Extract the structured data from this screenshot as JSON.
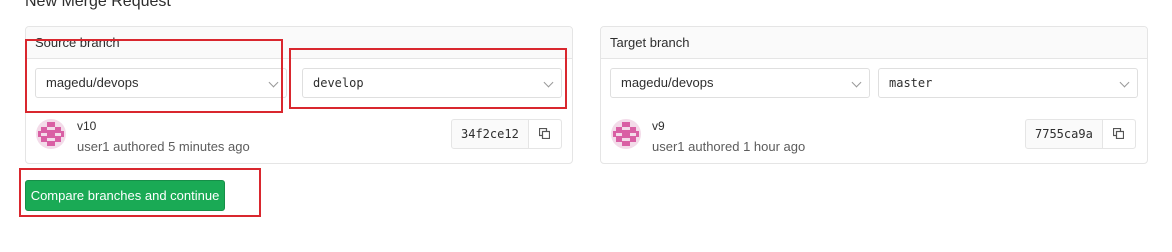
{
  "page": {
    "title": "New Merge Request"
  },
  "source": {
    "header": "Source branch",
    "project": "magedu/devops",
    "branch": "develop",
    "commit": {
      "title": "v10",
      "meta": "user1 authored 5 minutes ago",
      "sha": "34f2ce12"
    }
  },
  "target": {
    "header": "Target branch",
    "project": "magedu/devops",
    "branch": "master",
    "commit": {
      "title": "v9",
      "meta": "user1 authored 1 hour ago",
      "sha": "7755ca9a"
    }
  },
  "actions": {
    "compare_label": "Compare branches and continue"
  },
  "colors": {
    "accent_green": "#1aaa55",
    "annotation_red": "#d9272e",
    "avatar_pink": "#d95fa4"
  },
  "icons": {
    "chevron": "chevron-down-icon",
    "copy": "copy-icon",
    "avatar": "identicon-avatar"
  }
}
